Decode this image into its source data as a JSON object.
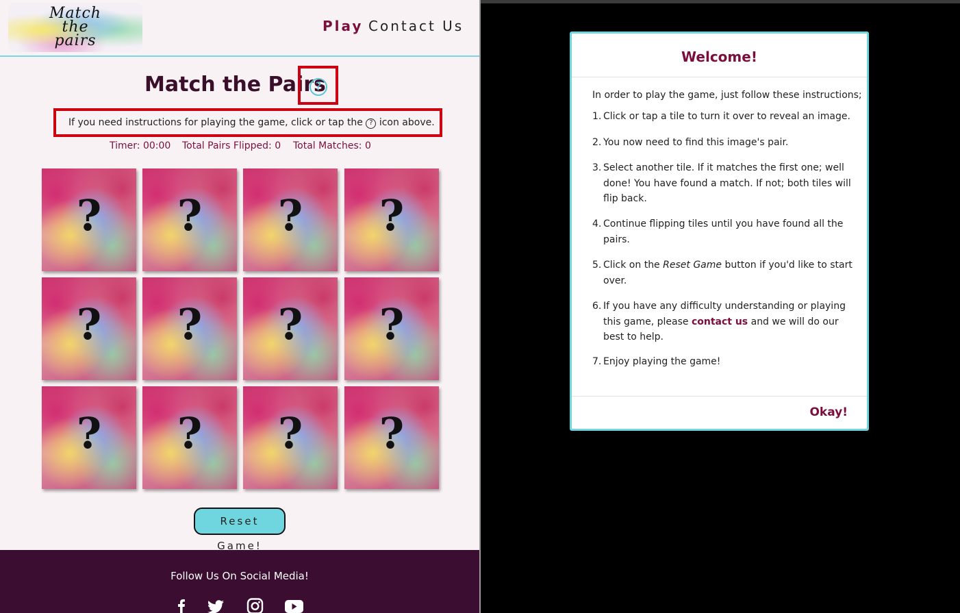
{
  "nav": {
    "logo_lines": [
      "Match",
      "the",
      "pairs"
    ],
    "play": "Play",
    "contact": "Contact Us"
  },
  "game": {
    "title": "Match the Pairs",
    "help_icon": "?",
    "instructions": "If you need instructions for playing the game, click or tap the",
    "instructions_icon": "?",
    "instructions_end": "icon above.",
    "timer": "Timer: 00:00",
    "pairs_flipped": "Total Pairs Flipped: 0",
    "matches": "Total Matches: 0",
    "tile_symbol": "?",
    "reset": "Reset Game!"
  },
  "footer": {
    "text": "Follow Us On Social Media!",
    "icons": [
      "facebook-icon",
      "twitter-icon",
      "instagram-icon",
      "youtube-icon"
    ]
  },
  "modal": {
    "title": "Welcome!",
    "intro": "In order to play the game, just follow these instructions;",
    "steps": [
      {
        "num": "1.",
        "text": "Click or tap a tile to turn it over to reveal an image."
      },
      {
        "num": "2.",
        "text": "You now need to find this image's pair."
      },
      {
        "num": "3.",
        "text": "Select another tile. If it matches the first one; well done! You have found a match. If not; both tiles will flip back."
      },
      {
        "num": "4.",
        "text": "Continue flipping tiles until you have found all the pairs."
      },
      {
        "num": "5.",
        "pre": "Click on the",
        "em": "Reset Game",
        "post": "button if you'd like to start over."
      },
      {
        "num": "6.",
        "pre": "If you have any difficulty understanding or playing this game, please",
        "link": "contact us",
        "post": "and we will do our best to help."
      },
      {
        "num": "7.",
        "text": "Enjoy playing the game!"
      }
    ],
    "okay": "Okay!"
  },
  "colors": {
    "accent": "#7a0f3d",
    "cyan": "#6fd6e0",
    "highlight_red": "#cc0010",
    "footer_bg": "#3b0d30"
  }
}
